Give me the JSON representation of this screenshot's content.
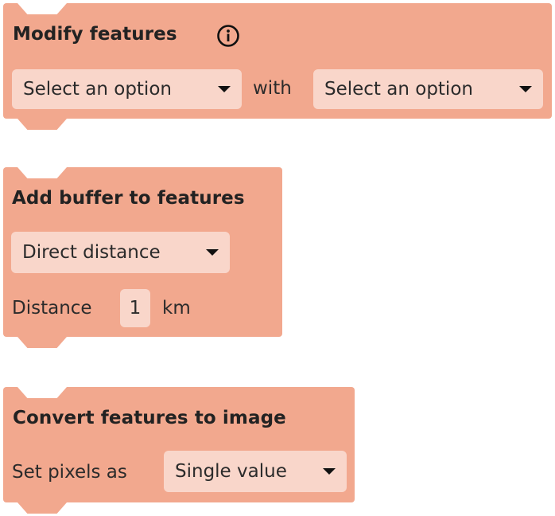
{
  "blocks": {
    "modify": {
      "title": "Modify features",
      "dropdown1": "Select an option",
      "with_label": "with",
      "dropdown2": "Select an option"
    },
    "buffer": {
      "title": "Add buffer to features",
      "dropdown": "Direct distance",
      "distance_label": "Distance",
      "distance_value": "1",
      "unit_label": "km"
    },
    "convert": {
      "title": "Convert features to image",
      "pixels_label": "Set pixels as",
      "dropdown": "Single value"
    }
  },
  "colors": {
    "block": "#f2a88e",
    "field": "#f9d6ca",
    "text": "#222222"
  },
  "icons": {
    "info": "info-icon",
    "caret": "caret-down-icon"
  }
}
